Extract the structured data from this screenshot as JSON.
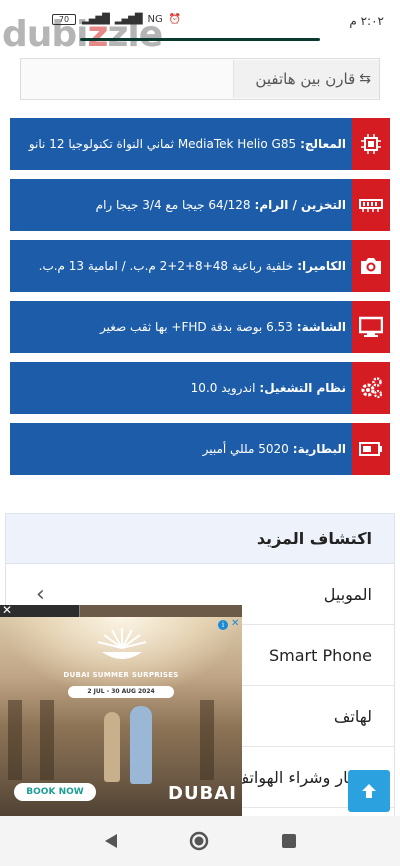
{
  "status": {
    "time": "٢:٠٢ م",
    "battery": "70",
    "network": "NG",
    "watermark_left": "dubi",
    "watermark_accent": "z",
    "watermark_right": "zle"
  },
  "compare": {
    "label": "قارن بين هاتفين",
    "icon": "compare-icon"
  },
  "specs": [
    {
      "label": "المعالج:",
      "value": "MediaTek Helio G85 ثماني النواة تكنولوجيا 12 نانو",
      "icon": "cpu-icon"
    },
    {
      "label": "التخزين / الرام:",
      "value": "64/128 جيجا مع 3/4 جيجا رام",
      "icon": "memory-icon"
    },
    {
      "label": "الكاميرا:",
      "value": "خلفية رباعية 48+8+2+2 م.ب. / امامية 13 م.ب.",
      "icon": "camera-icon"
    },
    {
      "label": "الشاشة:",
      "value": "6.53 بوصة بدقة FHD+ بها ثقب صغير",
      "icon": "monitor-icon"
    },
    {
      "label": "نظام التشغيل:",
      "value": "اندرويد 10.0",
      "icon": "gears-icon"
    },
    {
      "label": "البطارية:",
      "value": "5020 مللي أمبير",
      "icon": "battery-icon"
    }
  ],
  "explore": {
    "title": "اكتشاف المزيد",
    "items": [
      {
        "label": "الموبيل"
      },
      {
        "label": "Smart Phone"
      },
      {
        "label": "لهاتف"
      },
      {
        "label": "اختيار وشراء الهواتف"
      }
    ]
  },
  "ad": {
    "tagline": "DUBAI SUMMER SURPRISES",
    "dates": "2 JUL - 30 AUG 2024",
    "cta": "BOOK NOW",
    "brand": "DUBAI",
    "close": "✕"
  },
  "colors": {
    "spec_bg": "#1c5ca8",
    "spec_icon_bg": "#d61c23",
    "scroll_top": "#2ba1e0"
  }
}
